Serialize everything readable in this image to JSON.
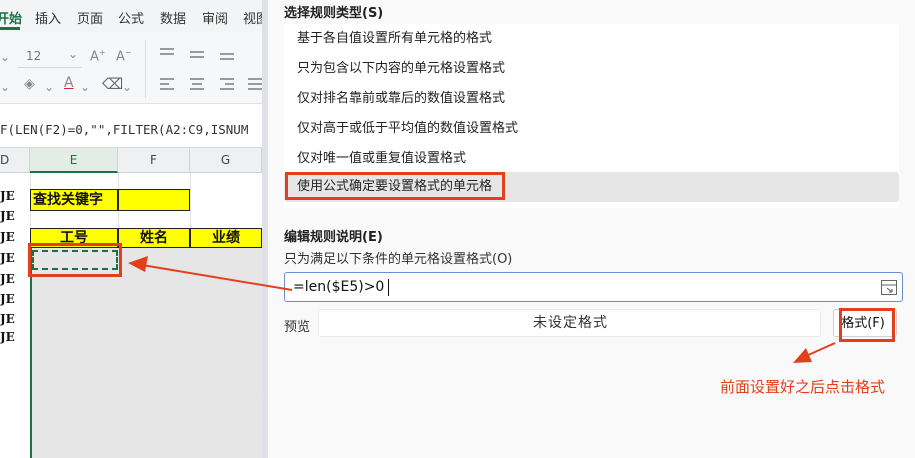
{
  "spreadsheet": {
    "ribbon_tabs": [
      "开始",
      "插入",
      "页面",
      "公式",
      "数据",
      "审阅",
      "视图"
    ],
    "active_tab": "开始",
    "font_size": "12",
    "formula_fragment": "F(LEN(F2)=0,\"\",FILTER(A2:C9,ISNUM",
    "column_headers": [
      "D",
      "E",
      "F",
      "G"
    ],
    "row_fragments": [
      "JE",
      "JE",
      "JE",
      "JE",
      "JE",
      "JE",
      "JE",
      "JE"
    ],
    "search_label": "查找关键字",
    "table_headers": [
      "工号",
      "姓名",
      "业绩"
    ]
  },
  "dialog": {
    "select_rule_type_title": "选择规则类型(S)",
    "rule_types": [
      "基于各自值设置所有单元格的格式",
      "只为包含以下内容的单元格设置格式",
      "仅对排名靠前或靠后的数值设置格式",
      "仅对高于或低于平均值的数值设置格式",
      "仅对唯一值或重复值设置格式",
      "使用公式确定要设置格式的单元格"
    ],
    "selected_rule_index": 5,
    "edit_rule_title": "编辑规则说明(E)",
    "formula_condition_label": "只为满足以下条件的单元格设置格式(O)",
    "formula_value": "=len($E5)>0",
    "preview_label": "预览",
    "preview_text": "未设定格式",
    "format_button": "格式(F)"
  },
  "annotation": {
    "note": "前面设置好之后点击格式",
    "color": "#e2401c"
  },
  "colors": {
    "accent_green": "#1e7145",
    "highlight_yellow": "#ffff00",
    "annotation_red": "#e2401c"
  }
}
